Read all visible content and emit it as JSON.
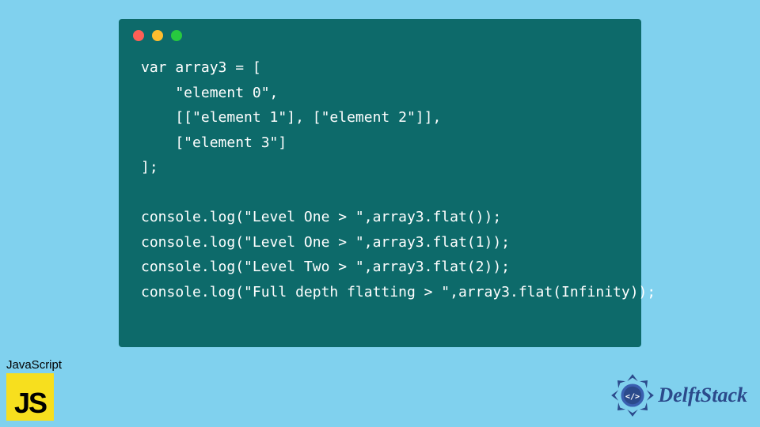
{
  "code": {
    "lines": [
      "var array3 = [",
      "    \"element 0\",",
      "    [[\"element 1\"], [\"element 2\"]],",
      "    [\"element 3\"]",
      "];",
      "",
      "console.log(\"Level One > \",array3.flat());",
      "console.log(\"Level One > \",array3.flat(1));",
      "console.log(\"Level Two > \",array3.flat(2));",
      "console.log(\"Full depth flatting > \",array3.flat(Infinity));"
    ]
  },
  "js_badge": {
    "label": "JavaScript",
    "logo_text": "JS"
  },
  "delft": {
    "text": "DelftStack"
  },
  "colors": {
    "bg": "#80d1ee",
    "window": "#0d6a6a",
    "js_yellow": "#f7df1e",
    "delft_blue": "#2b4a8b"
  }
}
